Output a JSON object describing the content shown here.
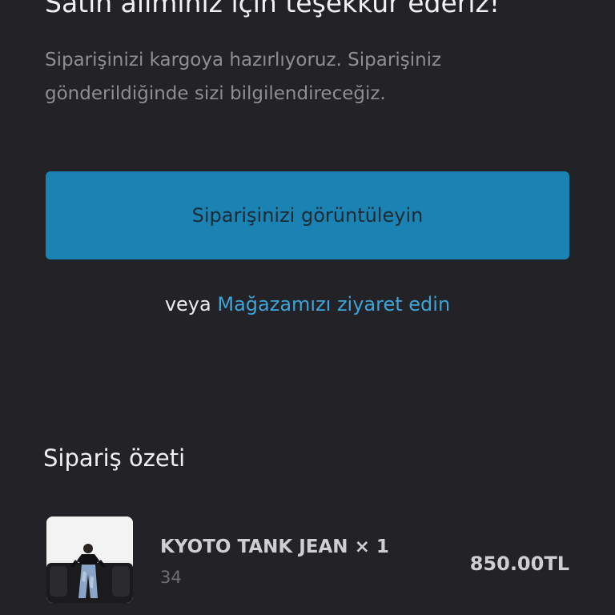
{
  "confirmation": {
    "heading": "Satın alımınız için teşekkür ederiz!",
    "message": "Siparişinizi kargoya hazırlıyoruz. Siparişiniz gönderildiğinde sizi bilgilendireceğiz."
  },
  "actions": {
    "view_order_label": "Siparişinizi görüntüleyin",
    "or_text": "veya",
    "visit_store_label": "Mağazamızı ziyaret edin",
    "button_color": "#1a83b3",
    "link_color": "#3ea3d9"
  },
  "order_summary": {
    "title": "Sipariş özeti",
    "items": [
      {
        "name": "KYOTO TANK JEAN × 1",
        "variant": "34",
        "price": "850.00TL"
      }
    ]
  }
}
